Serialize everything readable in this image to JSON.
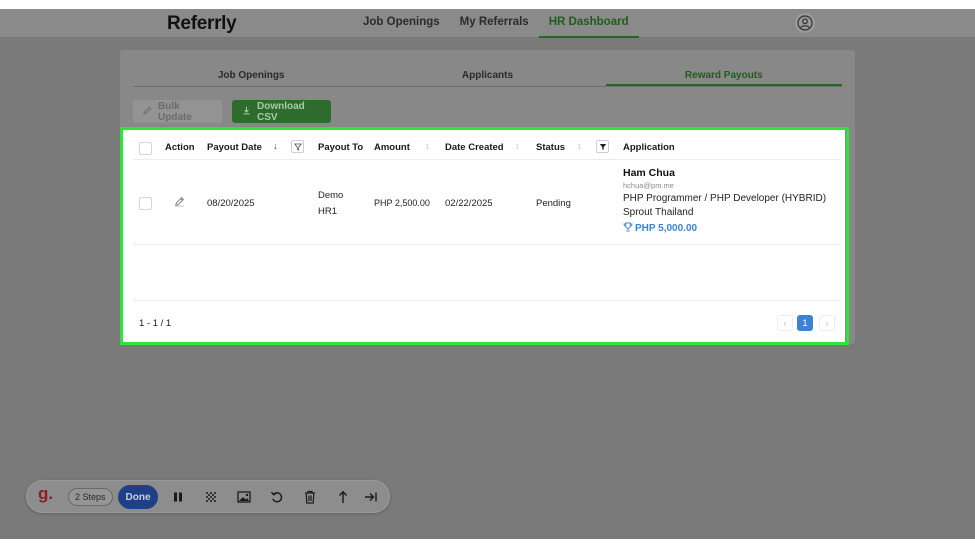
{
  "app": {
    "logo": "Referrly"
  },
  "nav": {
    "items": [
      {
        "label": "Job Openings"
      },
      {
        "label": "My Referrals"
      },
      {
        "label": "HR Dashboard"
      }
    ],
    "active": "HR Dashboard"
  },
  "tabs": {
    "items": [
      {
        "label": "Job Openings"
      },
      {
        "label": "Applicants"
      },
      {
        "label": "Reward Payouts"
      }
    ],
    "active": "Reward Payouts"
  },
  "actions": {
    "bulk_update": "Bulk Update",
    "download_csv": "Download CSV"
  },
  "table": {
    "columns": {
      "action": "Action",
      "payout_date": "Payout Date",
      "payout_to": "Payout To",
      "amount": "Amount",
      "date_created": "Date Created",
      "status": "Status",
      "application": "Application"
    },
    "rows": [
      {
        "payout_date": "08/20/2025",
        "payout_to": "Demo HR1",
        "amount": "PHP 2,500.00",
        "date_created": "02/22/2025",
        "status": "Pending",
        "applicant_name": "Ham Chua",
        "applicant_email": "hchua@pm.me",
        "job_title": "PHP Programmer / PHP Developer (HYBRID)",
        "company": "Sprout Thailand",
        "reward": "PHP 5,000.00"
      }
    ]
  },
  "pagination": {
    "range": "1 - 1 / 1",
    "current_page": "1",
    "prev": "‹",
    "next": "›"
  },
  "recorder": {
    "logo": "g.",
    "steps": "2 Steps",
    "done": "Done"
  },
  "colors": {
    "brand_green": "#1e6b1e",
    "highlight": "#2ee43a",
    "link_blue": "#3d83d4",
    "page_active": "#3c82d6",
    "done_blue": "#1f3f86"
  }
}
